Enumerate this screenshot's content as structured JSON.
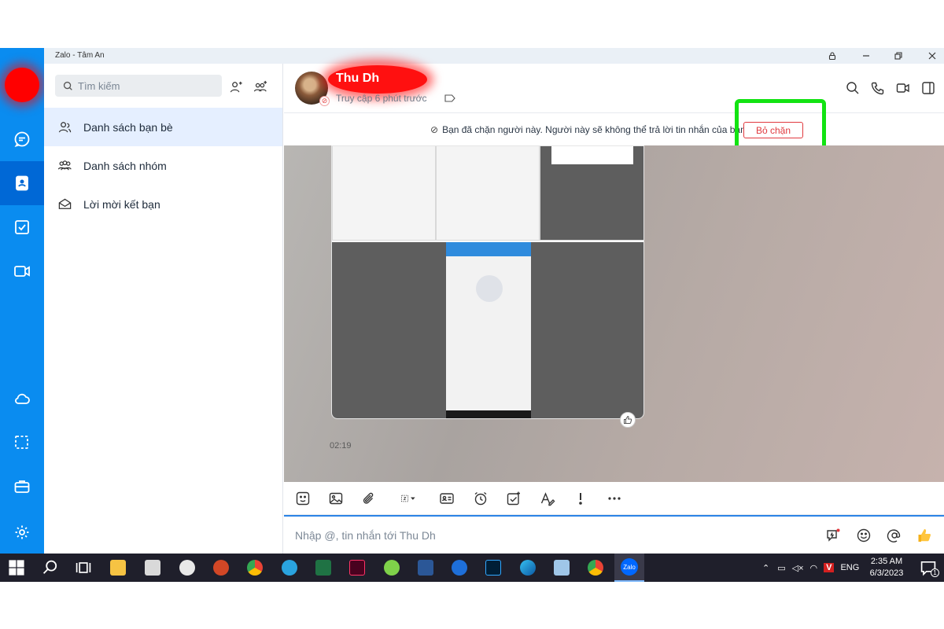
{
  "window": {
    "title": "Zalo - Tâm An"
  },
  "sidebar_contacts": {
    "search_placeholder": "Tìm kiếm",
    "items": [
      {
        "label": "Danh sách bạn bè",
        "active": true
      },
      {
        "label": "Danh sách nhóm"
      },
      {
        "label": "Lời mời kết bạn"
      }
    ]
  },
  "chat": {
    "contact_name": "Thu Dh",
    "status": "Truy cập 6 phút trước",
    "block_message": "Bạn đã chặn người này. Người này sẽ không thể trả lời tin nhắn của bạn",
    "unblock_label": "Bỏ chặn",
    "message_time": "02:19",
    "input_placeholder": "Nhập @, tin nhắn tới Thu Dh"
  },
  "taskbar": {
    "lang": "ENG",
    "time": "2:35 AM",
    "date": "6/3/2023",
    "zalo_label": "Zalo",
    "notification_count": "1"
  },
  "colors": {
    "rail": "#0a8cf0",
    "rail_active": "#0068d6",
    "highlight_box": "#12e312",
    "unblock": "#e0393e",
    "redaction": "#ff0000"
  }
}
